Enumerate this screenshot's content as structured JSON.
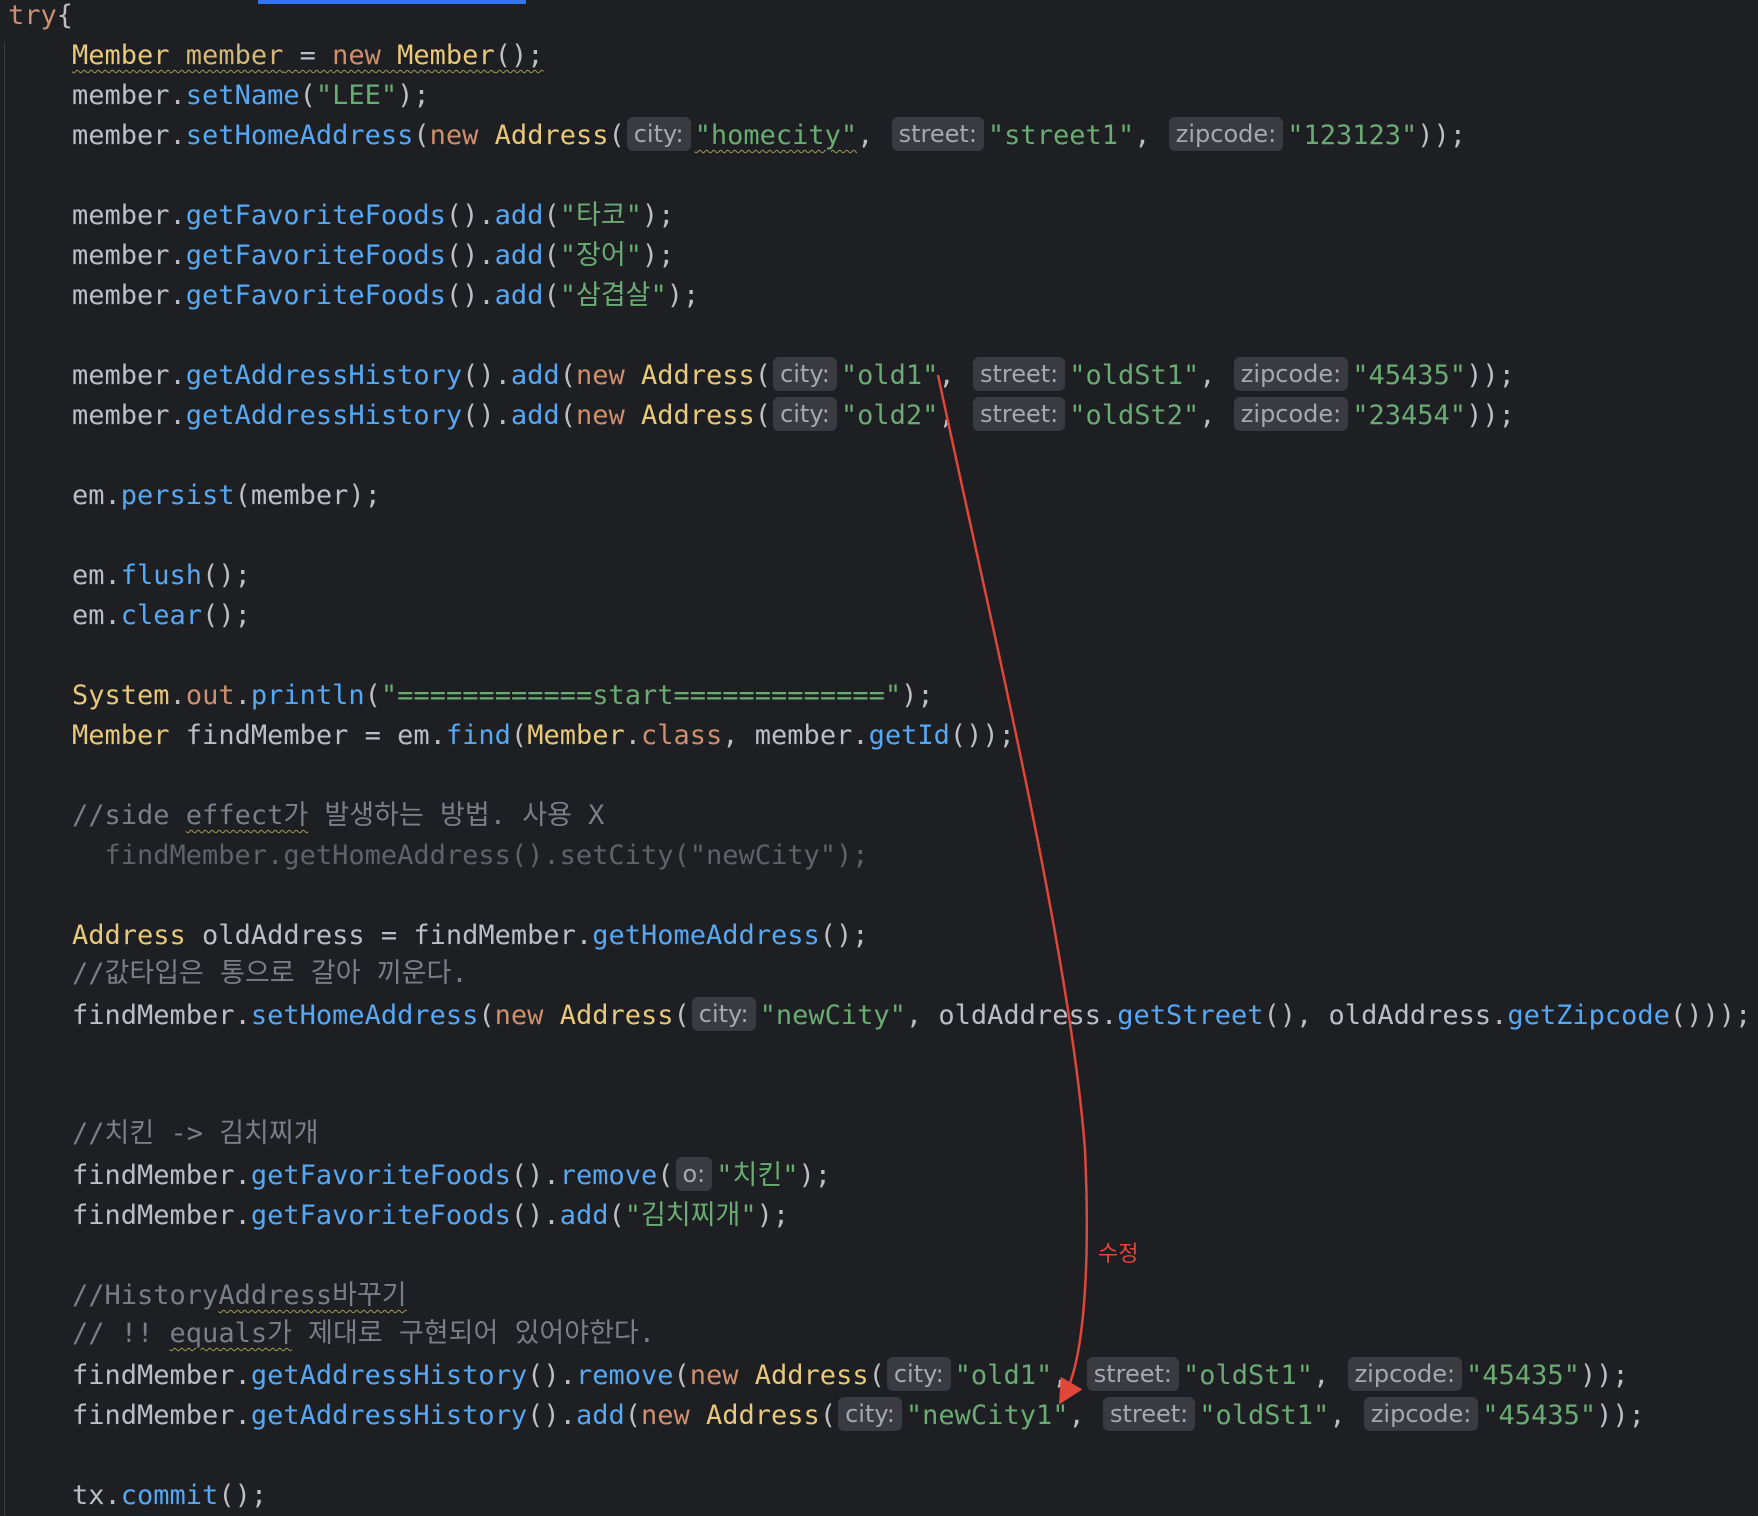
{
  "code": {
    "try_kw": "try",
    "try_brace": "{",
    "l2": {
      "t1": "Member",
      "t2": " member",
      "t3": " = ",
      "t4": "new",
      "t5": " Member",
      "t6": "();"
    },
    "l3": {
      "obj": "member.",
      "m": "setName",
      "a": "(",
      "s": "\"LEE\"",
      "e": ");"
    },
    "l4": {
      "obj": "member.",
      "m": "setHomeAddress",
      "a": "(",
      "kw": "new",
      "c": " Address",
      "p": "(",
      "h1": "city:",
      "s1": "\"homecity\"",
      "c1": ", ",
      "h2": "street:",
      "s2": "\"street1\"",
      "c2": ", ",
      "h3": "zipcode:",
      "s3": "\"123123\"",
      "e": "));"
    },
    "l5": {
      "obj": "member.",
      "m": "getFavoriteFoods",
      "p": "().",
      "m2": "add",
      "a": "(",
      "s": "\"타코\"",
      "e": ");"
    },
    "l6": {
      "obj": "member.",
      "m": "getFavoriteFoods",
      "p": "().",
      "m2": "add",
      "a": "(",
      "s": "\"장어\"",
      "e": ");"
    },
    "l7": {
      "obj": "member.",
      "m": "getFavoriteFoods",
      "p": "().",
      "m2": "add",
      "a": "(",
      "s": "\"삼겹살\"",
      "e": ");"
    },
    "l8": {
      "obj": "member.",
      "m": "getAddressHistory",
      "p": "().",
      "m2": "add",
      "a": "(",
      "kw": "new",
      "c": " Address",
      "pp": "(",
      "h1": "city:",
      "s1": "\"old1\"",
      "c1": ", ",
      "h2": "street:",
      "s2": "\"oldSt1\"",
      "c2": ", ",
      "h3": "zipcode:",
      "s3": "\"45435\"",
      "e": "));"
    },
    "l9": {
      "obj": "member.",
      "m": "getAddressHistory",
      "p": "().",
      "m2": "add",
      "a": "(",
      "kw": "new",
      "c": " Address",
      "pp": "(",
      "h1": "city:",
      "s1": "\"old2\"",
      "c1": ", ",
      "h2": "street:",
      "s2": "\"oldSt2\"",
      "c2": ", ",
      "h3": "zipcode:",
      "s3": "\"23454\"",
      "e": "));"
    },
    "l10": {
      "obj": "em.",
      "m": "persist",
      "e": "(member);"
    },
    "l11": {
      "obj": "em.",
      "m": "flush",
      "e": "();"
    },
    "l12": {
      "obj": "em.",
      "m": "clear",
      "e": "();"
    },
    "l13": {
      "c": "System",
      "d": ".",
      "f": "out",
      "d2": ".",
      "m": "println",
      "a": "(",
      "s": "\"============start=============\"",
      "e": ");"
    },
    "l14": {
      "c": "Member",
      "v": " findMember = em.",
      "m": "find",
      "a": "(",
      "c2": "Member",
      "d": ".",
      "kw": "class",
      "v2": ", member.",
      "m2": "getId",
      "e": "());"
    },
    "l15": {
      "pre": "//side ",
      "w": "effect가",
      "post": " 발생하는 방법. 사용 X"
    },
    "l16": {
      "t": "  findMember.getHomeAddress().setCity(\"newCity\");"
    },
    "l17": {
      "c": "Address",
      "v": " oldAddress = findMember.",
      "m": "getHomeAddress",
      "e": "();"
    },
    "l18": {
      "t": "//값타입은 통으로 갈아 끼운다."
    },
    "l19": {
      "obj": "findMember.",
      "m": "setHomeAddress",
      "a": "(",
      "kw": "new",
      "c": " Address",
      "p": "(",
      "h1": "city:",
      "s1": "\"newCity\"",
      "v": ", oldAddress.",
      "m2": "getStreet",
      "v2": "(), oldAddress.",
      "m3": "getZipcode",
      "e": "()));"
    },
    "l20": {
      "t": "//치킨 -> 김치찌개"
    },
    "l21": {
      "obj": "findMember.",
      "m": "getFavoriteFoods",
      "p": "().",
      "m2": "remove",
      "a": "(",
      "h1": "o:",
      "s": "\"치킨\"",
      "e": ");"
    },
    "l22": {
      "obj": "findMember.",
      "m": "getFavoriteFoods",
      "p": "().",
      "m2": "add",
      "a": "(",
      "s": "\"김치찌개\"",
      "e": ");"
    },
    "l23": {
      "pre": "//History",
      "w": "Address바꾸기"
    },
    "l24": {
      "pre": "// !! ",
      "w": "equals가",
      "post": " 제대로 구현되어 있어야한다."
    },
    "l25": {
      "obj": "findMember.",
      "m": "getAddressHistory",
      "p": "().",
      "m2": "remove",
      "a": "(",
      "kw": "new",
      "c": " Address",
      "pp": "(",
      "h1": "city:",
      "s1": "\"old1\"",
      "c1": ", ",
      "h2": "street:",
      "s2": "\"oldSt1\"",
      "c2": ", ",
      "h3": "zipcode:",
      "s3": "\"45435\"",
      "e": "));"
    },
    "l26": {
      "obj": "findMember.",
      "m": "getAddressHistory",
      "p": "().",
      "m2": "add",
      "a": "(",
      "kw": "new",
      "c": " Address",
      "pp": "(",
      "h1": "city:",
      "s1": "\"newCity1\"",
      "c1": ", ",
      "h2": "street:",
      "s2": "\"oldSt1\"",
      "c2": ", ",
      "h3": "zipcode:",
      "s3": "\"45435\"",
      "e": "));"
    },
    "l27": {
      "obj": "tx.",
      "m": "commit",
      "e": "();"
    }
  },
  "annotation": {
    "label": "수정",
    "color": "#e0463a"
  }
}
